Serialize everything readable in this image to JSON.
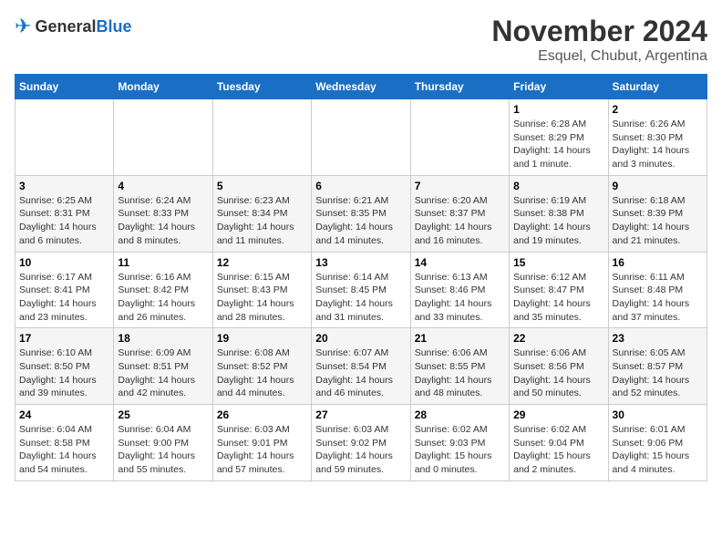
{
  "header": {
    "logo_general": "General",
    "logo_blue": "Blue",
    "month_title": "November 2024",
    "location": "Esquel, Chubut, Argentina"
  },
  "weekdays": [
    "Sunday",
    "Monday",
    "Tuesday",
    "Wednesday",
    "Thursday",
    "Friday",
    "Saturday"
  ],
  "weeks": [
    [
      {
        "day": "",
        "info": ""
      },
      {
        "day": "",
        "info": ""
      },
      {
        "day": "",
        "info": ""
      },
      {
        "day": "",
        "info": ""
      },
      {
        "day": "",
        "info": ""
      },
      {
        "day": "1",
        "info": "Sunrise: 6:28 AM\nSunset: 8:29 PM\nDaylight: 14 hours and 1 minute."
      },
      {
        "day": "2",
        "info": "Sunrise: 6:26 AM\nSunset: 8:30 PM\nDaylight: 14 hours and 3 minutes."
      }
    ],
    [
      {
        "day": "3",
        "info": "Sunrise: 6:25 AM\nSunset: 8:31 PM\nDaylight: 14 hours and 6 minutes."
      },
      {
        "day": "4",
        "info": "Sunrise: 6:24 AM\nSunset: 8:33 PM\nDaylight: 14 hours and 8 minutes."
      },
      {
        "day": "5",
        "info": "Sunrise: 6:23 AM\nSunset: 8:34 PM\nDaylight: 14 hours and 11 minutes."
      },
      {
        "day": "6",
        "info": "Sunrise: 6:21 AM\nSunset: 8:35 PM\nDaylight: 14 hours and 14 minutes."
      },
      {
        "day": "7",
        "info": "Sunrise: 6:20 AM\nSunset: 8:37 PM\nDaylight: 14 hours and 16 minutes."
      },
      {
        "day": "8",
        "info": "Sunrise: 6:19 AM\nSunset: 8:38 PM\nDaylight: 14 hours and 19 minutes."
      },
      {
        "day": "9",
        "info": "Sunrise: 6:18 AM\nSunset: 8:39 PM\nDaylight: 14 hours and 21 minutes."
      }
    ],
    [
      {
        "day": "10",
        "info": "Sunrise: 6:17 AM\nSunset: 8:41 PM\nDaylight: 14 hours and 23 minutes."
      },
      {
        "day": "11",
        "info": "Sunrise: 6:16 AM\nSunset: 8:42 PM\nDaylight: 14 hours and 26 minutes."
      },
      {
        "day": "12",
        "info": "Sunrise: 6:15 AM\nSunset: 8:43 PM\nDaylight: 14 hours and 28 minutes."
      },
      {
        "day": "13",
        "info": "Sunrise: 6:14 AM\nSunset: 8:45 PM\nDaylight: 14 hours and 31 minutes."
      },
      {
        "day": "14",
        "info": "Sunrise: 6:13 AM\nSunset: 8:46 PM\nDaylight: 14 hours and 33 minutes."
      },
      {
        "day": "15",
        "info": "Sunrise: 6:12 AM\nSunset: 8:47 PM\nDaylight: 14 hours and 35 minutes."
      },
      {
        "day": "16",
        "info": "Sunrise: 6:11 AM\nSunset: 8:48 PM\nDaylight: 14 hours and 37 minutes."
      }
    ],
    [
      {
        "day": "17",
        "info": "Sunrise: 6:10 AM\nSunset: 8:50 PM\nDaylight: 14 hours and 39 minutes."
      },
      {
        "day": "18",
        "info": "Sunrise: 6:09 AM\nSunset: 8:51 PM\nDaylight: 14 hours and 42 minutes."
      },
      {
        "day": "19",
        "info": "Sunrise: 6:08 AM\nSunset: 8:52 PM\nDaylight: 14 hours and 44 minutes."
      },
      {
        "day": "20",
        "info": "Sunrise: 6:07 AM\nSunset: 8:54 PM\nDaylight: 14 hours and 46 minutes."
      },
      {
        "day": "21",
        "info": "Sunrise: 6:06 AM\nSunset: 8:55 PM\nDaylight: 14 hours and 48 minutes."
      },
      {
        "day": "22",
        "info": "Sunrise: 6:06 AM\nSunset: 8:56 PM\nDaylight: 14 hours and 50 minutes."
      },
      {
        "day": "23",
        "info": "Sunrise: 6:05 AM\nSunset: 8:57 PM\nDaylight: 14 hours and 52 minutes."
      }
    ],
    [
      {
        "day": "24",
        "info": "Sunrise: 6:04 AM\nSunset: 8:58 PM\nDaylight: 14 hours and 54 minutes."
      },
      {
        "day": "25",
        "info": "Sunrise: 6:04 AM\nSunset: 9:00 PM\nDaylight: 14 hours and 55 minutes."
      },
      {
        "day": "26",
        "info": "Sunrise: 6:03 AM\nSunset: 9:01 PM\nDaylight: 14 hours and 57 minutes."
      },
      {
        "day": "27",
        "info": "Sunrise: 6:03 AM\nSunset: 9:02 PM\nDaylight: 14 hours and 59 minutes."
      },
      {
        "day": "28",
        "info": "Sunrise: 6:02 AM\nSunset: 9:03 PM\nDaylight: 15 hours and 0 minutes."
      },
      {
        "day": "29",
        "info": "Sunrise: 6:02 AM\nSunset: 9:04 PM\nDaylight: 15 hours and 2 minutes."
      },
      {
        "day": "30",
        "info": "Sunrise: 6:01 AM\nSunset: 9:06 PM\nDaylight: 15 hours and 4 minutes."
      }
    ]
  ]
}
